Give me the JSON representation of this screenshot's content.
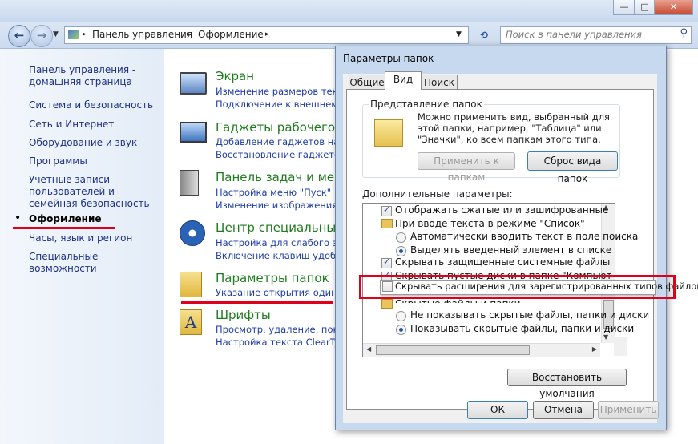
{
  "window": {
    "minimize": "—",
    "maximize": "□",
    "close": "✕"
  },
  "address": {
    "path": [
      "Панель управления",
      "Оформление"
    ],
    "search_placeholder": "Поиск в панели управления"
  },
  "sidebar": {
    "items": [
      {
        "label": "Панель управления - домашняя страница"
      },
      {
        "label": "Система и безопасность"
      },
      {
        "label": "Сеть и Интернет"
      },
      {
        "label": "Оборудование и звук"
      },
      {
        "label": "Программы"
      },
      {
        "label": "Учетные записи пользователей и семейная безопасность"
      },
      {
        "label": "Оформление",
        "active": true
      },
      {
        "label": "Часы, язык и регион"
      },
      {
        "label": "Специальные возможности"
      }
    ]
  },
  "categories": [
    {
      "title": "Экран",
      "links": [
        "Изменение размеров текст",
        "Подключение к внешнему"
      ],
      "icon": "display-icon"
    },
    {
      "title": "Гаджеты рабочего ст",
      "links": [
        "Добавление гаджетов на р",
        "Восстановление гаджетов"
      ],
      "icon": "gadgets-icon"
    },
    {
      "title": "Панель задач и меню",
      "links": [
        "Настройка меню \"Пуск\"",
        "Изменение изображения"
      ],
      "icon": "taskbar-icon"
    },
    {
      "title": "Центр специальных",
      "links": [
        "Настройка для слабого зре",
        "Включение клавиш удобн"
      ],
      "icon": "ease-of-access-icon"
    },
    {
      "title": "Параметры папок",
      "links": [
        "Указание открытия одино"
      ],
      "icon": "folder-options-icon"
    },
    {
      "title": "Шрифты",
      "links": [
        "Просмотр, удаление, показ",
        "Настройка текста ClearType"
      ],
      "icon": "fonts-icon"
    }
  ],
  "dialog": {
    "title": "Параметры папок",
    "tabs": [
      "Общие",
      "Вид",
      "Поиск"
    ],
    "active_tab": "Вид",
    "folder_view": {
      "group_label": "Представление папок",
      "description": "Можно применить вид, выбранный для этой папки, например, \"Таблица\" или \"Значки\", ко всем папкам этого типа.",
      "apply_button": "Применить к папкам",
      "reset_button": "Сброс вида папок"
    },
    "advanced_label": "Дополнительные параметры:",
    "advanced_items": [
      {
        "type": "checkbox",
        "checked": true,
        "label": "Отображать сжатые или зашифрованные файлы NT"
      },
      {
        "type": "folder",
        "label": "При вводе текста в режиме \"Список\""
      },
      {
        "type": "radio",
        "checked": false,
        "label": "Автоматически вводить текст в поле поиска"
      },
      {
        "type": "radio",
        "checked": true,
        "label": "Выделять введенный элемент в списке"
      },
      {
        "type": "checkbox",
        "checked": true,
        "label": "Скрывать защищенные системные файлы (рекомен"
      },
      {
        "type": "checkbox",
        "checked": true,
        "label": "Скрывать пустые диски в папке \"Компьютер\""
      },
      {
        "type": "checkbox",
        "checked": false,
        "label": "Скрывать расширения для зарегистрированных типов файлов"
      },
      {
        "type": "folder",
        "label": "Скрытые файлы и папки"
      },
      {
        "type": "radio",
        "checked": false,
        "label": "Не показывать скрытые файлы, папки и диски"
      },
      {
        "type": "radio",
        "checked": true,
        "label": "Показывать скрытые файлы, папки и диски"
      }
    ],
    "restore_button": "Восстановить умолчания",
    "ok_button": "ОК",
    "cancel_button": "Отмена",
    "apply_button": "Применить"
  },
  "colors": {
    "highlight": "#e0001b",
    "accent_green": "#1e7b1e",
    "link_blue": "#1e3ca8"
  }
}
